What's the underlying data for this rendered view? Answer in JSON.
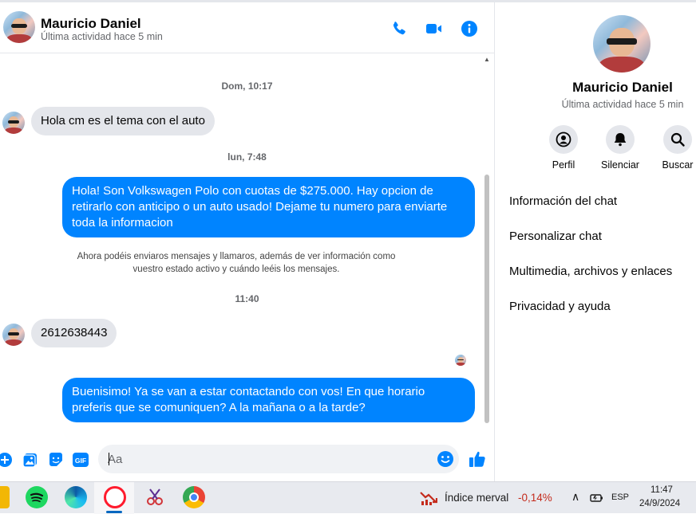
{
  "contact": {
    "name": "Mauricio Daniel",
    "status": "Última actividad hace 5 min"
  },
  "messages": {
    "ts_1": "Dom, 10:17",
    "msg_1": "Hola cm es el tema con el auto",
    "ts_2": "lun, 7:48",
    "msg_2": "Hola! Son Volkswagen Polo con cuotas de $275.000. Hay opcion de retirarlo con anticipo o un auto usado! Dejame tu numero para enviarte toda la informacion",
    "notice": "Ahora podéis enviaros mensajes y llamaros, además de ver información como vuestro estado activo y cuándo leéis los mensajes.",
    "ts_3": "11:40",
    "msg_3": "2612638443",
    "msg_4": "Buenisimo! Ya se van a estar contactando con vos! En que horario preferis que se comuniquen? A la mañana o a la tarde?"
  },
  "composer": {
    "placeholder": "Aa"
  },
  "info_panel": {
    "actions": [
      "Perfil",
      "Silenciar",
      "Buscar"
    ],
    "menu": [
      "Información del chat",
      "Personalizar chat",
      "Multimedia, archivos y enlaces",
      "Privacidad y ayuda"
    ]
  },
  "taskbar": {
    "widget_label": "Índice merval",
    "widget_value": "-0,14%",
    "language": "ESP",
    "time": "11:47",
    "date": "24/9/2024"
  },
  "colors": {
    "accent": "#0084ff",
    "bubble_in": "#e4e6eb",
    "negative": "#c42b1c"
  },
  "icons": [
    "phone-icon",
    "video-icon",
    "info-icon",
    "plus-icon",
    "image-icon",
    "sticker-icon",
    "gif-icon",
    "emoji-icon",
    "like-icon",
    "profile-icon",
    "bell-icon",
    "search-icon"
  ]
}
